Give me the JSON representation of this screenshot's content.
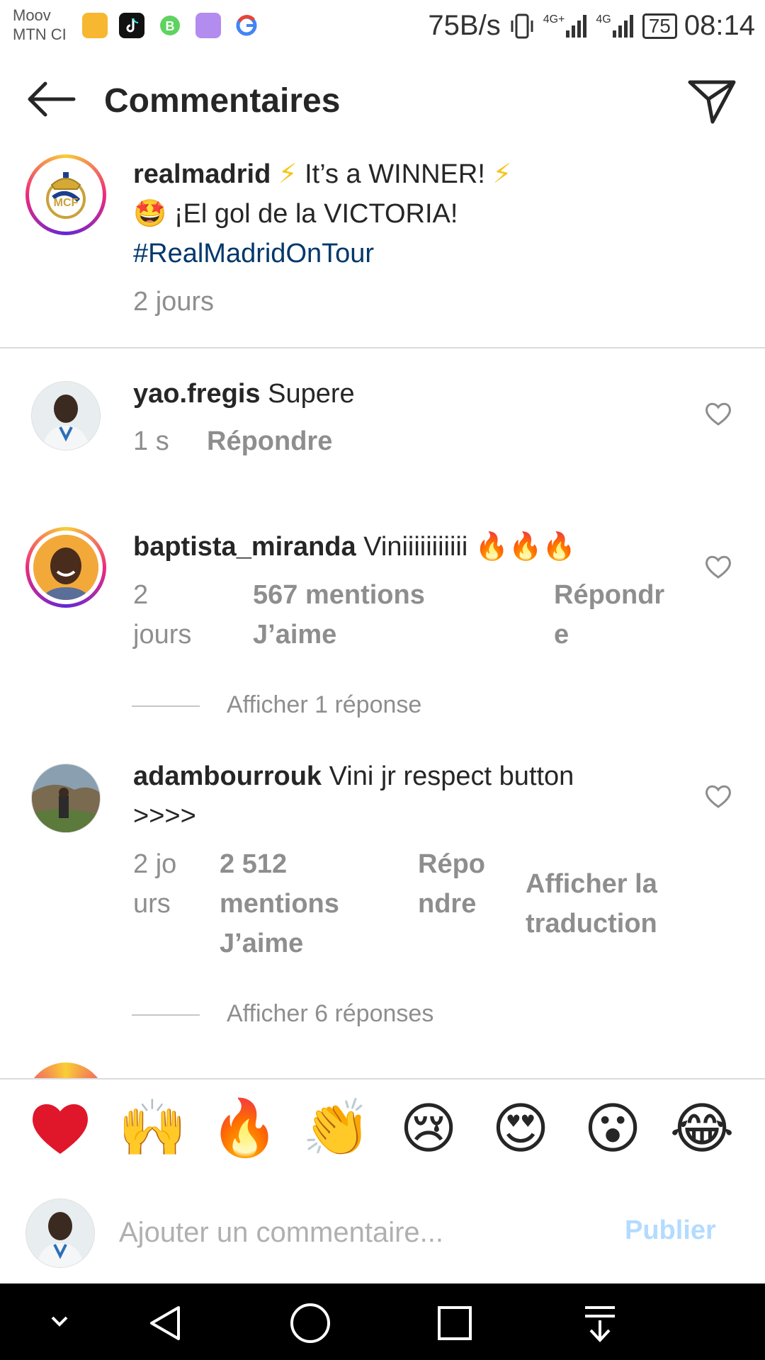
{
  "status_bar": {
    "carrier_1": "Moov",
    "carrier_2": "MTN CI",
    "net_speed": "75B/s",
    "net_1": "4G+",
    "net_2": "4G",
    "battery": "75",
    "time": "08:14"
  },
  "header": {
    "title": "Commentaires"
  },
  "post": {
    "username": "realmadrid",
    "line1": "It’s a WINNER!",
    "line2": "¡El gol de la VICTORIA!",
    "hashtag": "#RealMadridOnTour",
    "age": "2 jours"
  },
  "comments": [
    {
      "username": "yao.fregis",
      "text": "Supere",
      "age": "1 s",
      "reply": "Répondre"
    },
    {
      "username": "baptista_miranda",
      "text": "Viniiiiiiiiiii",
      "age": "2 jours",
      "likes": "567 mentions J’aime",
      "reply": "Répondre",
      "view_replies": "Afficher 1 réponse"
    },
    {
      "username": "adambourrouk",
      "text": "Vini jr respect button >>>>",
      "age": "2 jours",
      "likes": "2 512 mentions J’aime",
      "reply": "Répondre",
      "translate": "Afficher la traduction",
      "view_replies": "Afficher 6 réponses"
    }
  ],
  "emoji_bar": [
    "heart",
    "raising-hands",
    "fire",
    "clapping-hands",
    "sad-face",
    "heart-eyes-face",
    "surprised-face",
    "tears-of-joy-face"
  ],
  "comment_box": {
    "placeholder": "Ajouter un commentaire...",
    "publish": "Publier"
  },
  "colors": {
    "link": "#00376b",
    "muted": "#8e8e8e",
    "publish_disabled": "#b3dbff",
    "story_ring": "#ee2a7b"
  }
}
